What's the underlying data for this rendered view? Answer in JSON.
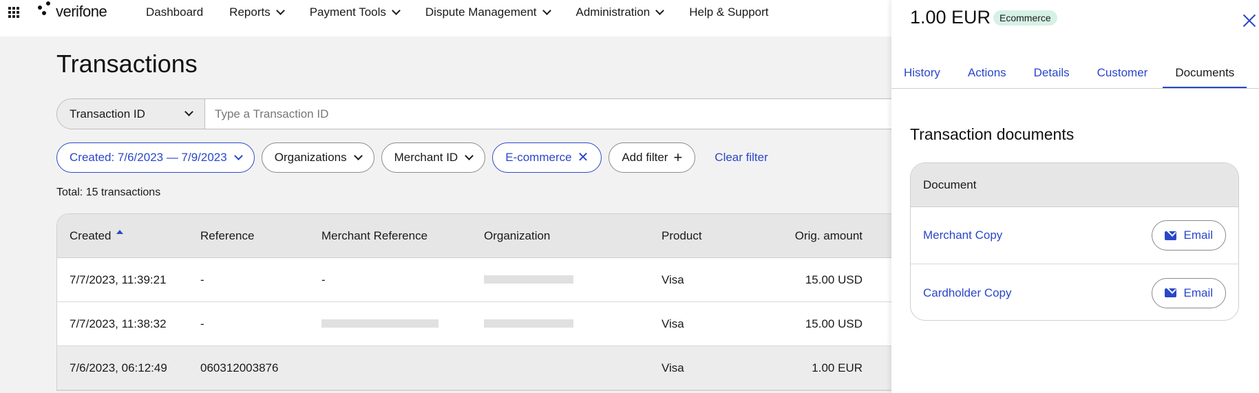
{
  "nav": {
    "logo_text": "verifone",
    "items": [
      {
        "label": "Dashboard",
        "dropdown": false
      },
      {
        "label": "Reports",
        "dropdown": true
      },
      {
        "label": "Payment Tools",
        "dropdown": true
      },
      {
        "label": "Dispute Management",
        "dropdown": true
      },
      {
        "label": "Administration",
        "dropdown": true
      },
      {
        "label": "Help & Support",
        "dropdown": false
      }
    ]
  },
  "page": {
    "title": "Transactions"
  },
  "search": {
    "type_label": "Transaction ID",
    "placeholder": "Type a Transaction ID",
    "value": ""
  },
  "filters": {
    "created": "Created: 7/6/2023 — 7/9/2023",
    "organizations": "Organizations",
    "merchant_id": "Merchant ID",
    "ecommerce": "E-commerce",
    "add_filter": "Add filter",
    "clear": "Clear filter"
  },
  "total_label": "Total: 15 transactions",
  "table": {
    "headers": {
      "created": "Created",
      "reference": "Reference",
      "merchant_reference": "Merchant Reference",
      "organization": "Organization",
      "product": "Product",
      "orig_amount": "Orig. amount"
    },
    "rows": [
      {
        "created": "7/7/2023, 11:39:21",
        "reference": "-",
        "merchant_reference": "-",
        "product": "Visa",
        "amount": "15.00 USD"
      },
      {
        "created": "7/7/2023, 11:38:32",
        "reference": "-",
        "merchant_reference": "",
        "product": "Visa",
        "amount": "15.00 USD"
      },
      {
        "created": "7/6/2023, 06:12:49",
        "reference": "060312003876",
        "merchant_reference": "",
        "product": "Visa",
        "amount": "1.00 EUR"
      }
    ]
  },
  "panel": {
    "amount": "1.00 EUR",
    "badge": "Ecommerce",
    "tabs": [
      "History",
      "Actions",
      "Details",
      "Customer",
      "Documents"
    ],
    "active_tab": "Documents",
    "section_title": "Transaction documents",
    "docs_header": "Document",
    "documents": [
      {
        "name": "Merchant Copy",
        "action": "Email"
      },
      {
        "name": "Cardholder Copy",
        "action": "Email"
      }
    ]
  },
  "colors": {
    "accent": "#2a47c8",
    "badge_bg": "#d6f1e6"
  }
}
